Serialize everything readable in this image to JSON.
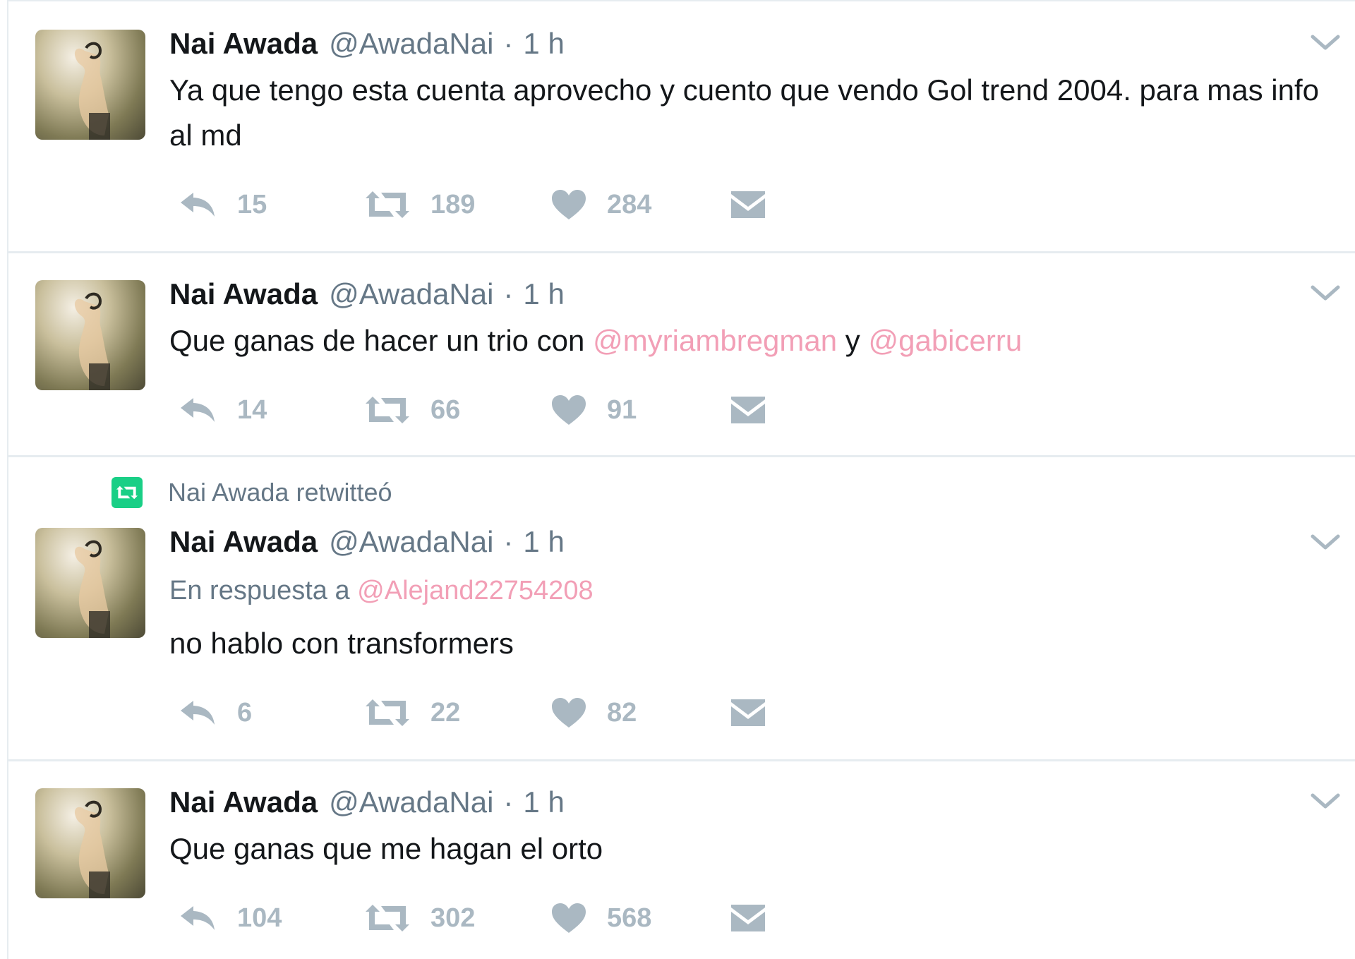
{
  "tweets": [
    {
      "author_name": "Nai Awada",
      "author_handle": "@AwadaNai",
      "separator": "·",
      "time": "1 h",
      "text": "Ya que tengo esta cuenta aprovecho y cuento que vendo Gol trend 2004. para mas info al md",
      "replies": "15",
      "retweets": "189",
      "likes": "284"
    },
    {
      "author_name": "Nai Awada",
      "author_handle": "@AwadaNai",
      "separator": "·",
      "time": "1 h",
      "text_before": "Que ganas de hacer un trio con ",
      "mention_1": "@myriambregman",
      "text_middle": " y ",
      "mention_2": "@gabicerru",
      "replies": "14",
      "retweets": "66",
      "likes": "91"
    },
    {
      "retweet_context": "Nai Awada retwitteó",
      "author_name": "Nai Awada",
      "author_handle": "@AwadaNai",
      "separator": "·",
      "time": "1 h",
      "reply_prefix": "En respuesta a ",
      "reply_to": "@Alejand22754208",
      "text": "no hablo con transformers",
      "replies": "6",
      "retweets": "22",
      "likes": "82"
    },
    {
      "author_name": "Nai Awada",
      "author_handle": "@AwadaNai",
      "separator": "·",
      "time": "1 h",
      "text": "Que ganas que me hagan el orto",
      "replies": "104",
      "retweets": "302",
      "likes": "568"
    }
  ],
  "icons": {
    "reply": "reply-icon",
    "retweet": "retweet-icon",
    "like": "heart-icon",
    "message": "envelope-icon",
    "menu": "chevron-down-icon",
    "retweet_context": "retweet-badge-icon"
  },
  "colors": {
    "text": "#14171a",
    "secondary": "#657786",
    "action_icon": "#aab8c2",
    "mention": "#f29fb6",
    "retweet_badge": "#19cf86",
    "divider": "#e6ecf0"
  }
}
